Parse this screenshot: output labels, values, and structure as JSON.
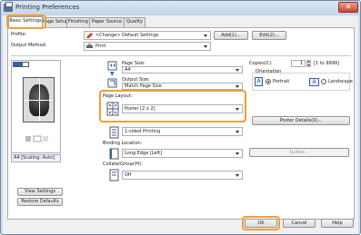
{
  "window": {
    "title": "Printing Preferences",
    "close_glyph": "✕"
  },
  "tabs": [
    "Basic Settings",
    "Page Setup",
    "Finishing",
    "Paper Source",
    "Quality"
  ],
  "profile": {
    "label": "Profile:",
    "value": "<Change> Default Settings",
    "add_button": "Add(1)...",
    "edit_button": "Edit(2)..."
  },
  "output_method": {
    "label": "Output Method:",
    "value": "Print"
  },
  "page_size": {
    "label": "Page Size:",
    "value": "A4"
  },
  "output_size": {
    "label": "Output Size:",
    "value": "Match Page Size"
  },
  "copies": {
    "label": "Copies(C):",
    "value": "1",
    "range": "[1 to 9999]"
  },
  "orientation": {
    "label": "Orientation",
    "portrait": "Portrait",
    "landscape": "Landscape",
    "portrait_letter": "A",
    "landscape_letter": "A"
  },
  "page_layout": {
    "label": "Page Layout:",
    "value": "Poster [2 x 2]"
  },
  "poster_details_button": "Poster Details(X)...",
  "printing_method": {
    "value": "1-sided Printing"
  },
  "binding_location": {
    "label": "Binding Location:",
    "value": "Long Edge [Left]",
    "gutter_button": "Gutter..."
  },
  "collate": {
    "label": "Collate/Group(H):",
    "value": "Off"
  },
  "preview": {
    "caption": "A4 [Scaling: Auto]"
  },
  "left_buttons": {
    "view_settings": "View Settings",
    "restore_defaults": "Restore Defaults"
  },
  "footer": {
    "ok": "OK",
    "cancel": "Cancel",
    "help": "Help"
  },
  "colors": {
    "highlight": "#f0a030",
    "titlebar": "#c3d4ea",
    "accent": "#3a5f9a"
  }
}
